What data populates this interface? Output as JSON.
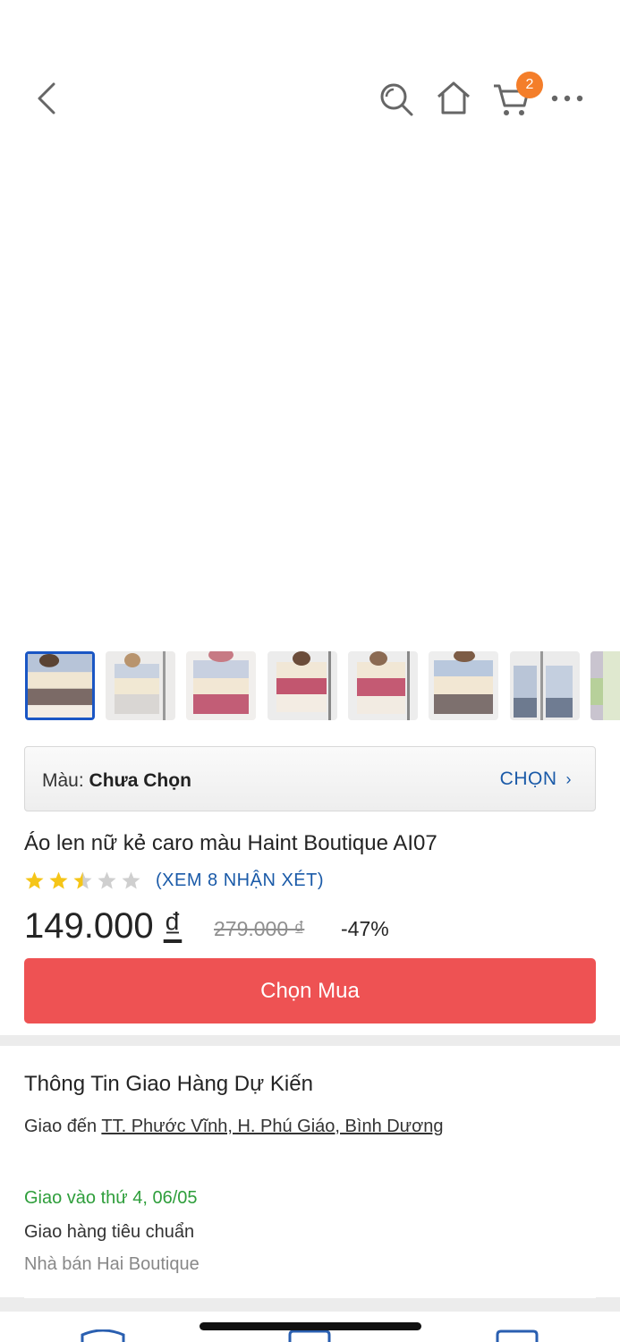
{
  "topbar": {
    "cart_count": "2"
  },
  "product": {
    "variant_label": "Màu:",
    "variant_value": "Chưa Chọn",
    "variant_action": "CHỌN",
    "title": "Áo len nữ kẻ caro màu Haint Boutique AI07",
    "rating": 2.5,
    "rating_max": 5,
    "reviews_link": "(XEM 8 NHẬN XÉT)",
    "price": "149.000",
    "price_currency": "₫",
    "old_price": "279.000 ₫",
    "discount": "-47%",
    "buy_label": "Chọn Mua"
  },
  "shipping": {
    "title": "Thông Tin Giao Hàng Dự Kiến",
    "to_label": "Giao đến",
    "address": "TT. Phước Vĩnh, H. Phú Giáo, Bình Dương",
    "date": "Giao vào thứ 4, 06/05",
    "method": "Giao hàng tiêu chuẩn",
    "seller": "Nhà bán Hai Boutique"
  },
  "colors": {
    "accent_blue": "#1a5aa8",
    "buy_red": "#ee5253",
    "badge_orange": "#f47e2a",
    "ship_green": "#2e9e3b",
    "star_yellow": "#f5c518"
  },
  "thumbnails": [
    {
      "name": "thumb-1",
      "selected": true
    },
    {
      "name": "thumb-2",
      "selected": false
    },
    {
      "name": "thumb-3",
      "selected": false
    },
    {
      "name": "thumb-4",
      "selected": false
    },
    {
      "name": "thumb-5",
      "selected": false
    },
    {
      "name": "thumb-6",
      "selected": false
    },
    {
      "name": "thumb-7",
      "selected": false
    },
    {
      "name": "thumb-8",
      "selected": false
    }
  ]
}
